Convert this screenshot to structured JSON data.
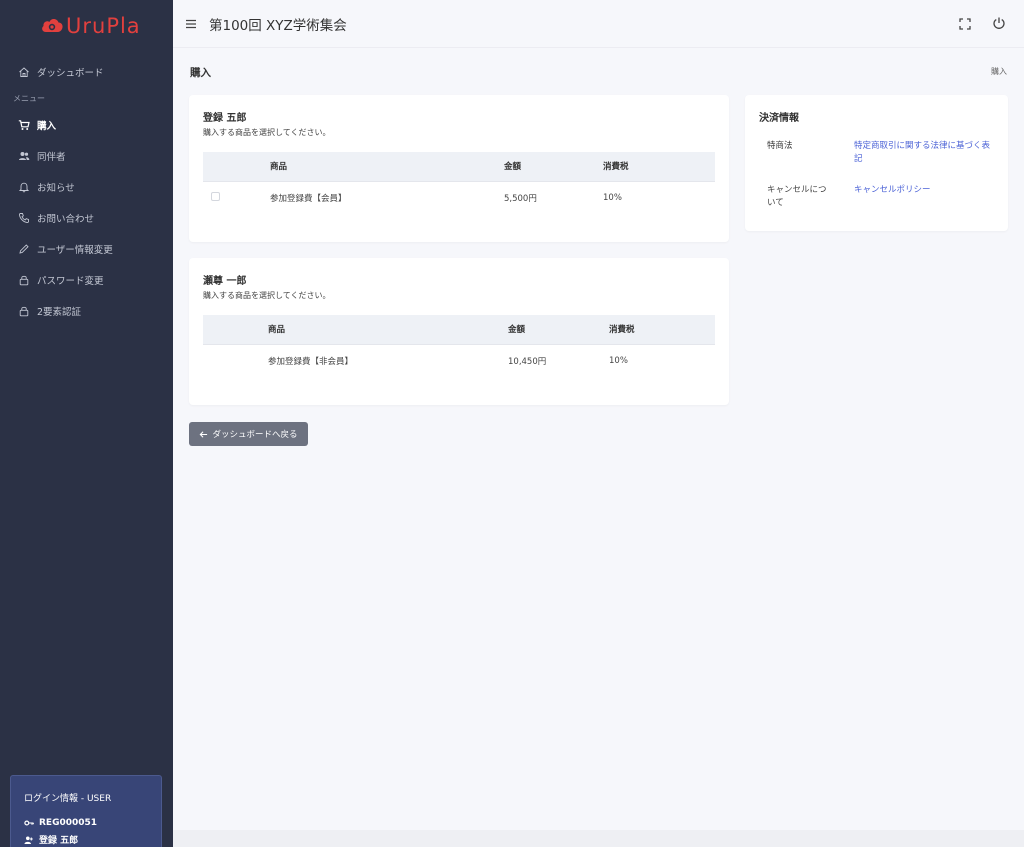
{
  "sidebar": {
    "logo_text": "UruPla",
    "brand_color": "#e2403e",
    "dashboard_label": "ダッシュボード",
    "section_label": "メニュー",
    "items": [
      {
        "label": "購入",
        "icon": "cart-icon",
        "active": true
      },
      {
        "label": "同伴者",
        "icon": "users-icon",
        "active": false
      },
      {
        "label": "お知らせ",
        "icon": "bell-icon",
        "active": false
      },
      {
        "label": "お問い合わせ",
        "icon": "phone-icon",
        "active": false
      },
      {
        "label": "ユーザー情報変更",
        "icon": "pencil-icon",
        "active": false
      },
      {
        "label": "パスワード変更",
        "icon": "lock-icon",
        "active": false
      },
      {
        "label": "2要素認証",
        "icon": "lock-icon",
        "active": false
      }
    ],
    "login": {
      "title": "ログイン情報 - USER",
      "id": "REG000051",
      "name": "登録 五郎"
    }
  },
  "header": {
    "title": "第100回 XYZ学術集会"
  },
  "page": {
    "title": "購入",
    "breadcrumb": "購入"
  },
  "purchase_cards": [
    {
      "name": "登録 五郎",
      "subtitle": "購入する商品を選択してください。",
      "columns": [
        "商品",
        "金額",
        "消費税"
      ],
      "rows": [
        {
          "product": "参加登録費【会員】",
          "price": "5,500円",
          "tax": "10%"
        }
      ]
    },
    {
      "name": "瀬尊 一郎",
      "subtitle": "購入する商品を選択してください。",
      "columns": [
        "商品",
        "金額",
        "消費税"
      ],
      "rows": [
        {
          "product": "参加登録費【非会員】",
          "price": "10,450円",
          "tax": "10%"
        }
      ]
    }
  ],
  "settlement": {
    "title": "決済情報",
    "rows": [
      {
        "label": "特商法",
        "link": "特定商取引に関する法律に基づく表記"
      },
      {
        "label": "キャンセルについて",
        "link": "キャンセルポリシー"
      }
    ]
  },
  "back_button": "ダッシュボードへ戻る",
  "colors": {
    "sidebar_bg": "#2b3145",
    "login_box_bg": "#384577",
    "link": "#4a61d6",
    "button_bg": "#6d7280"
  }
}
